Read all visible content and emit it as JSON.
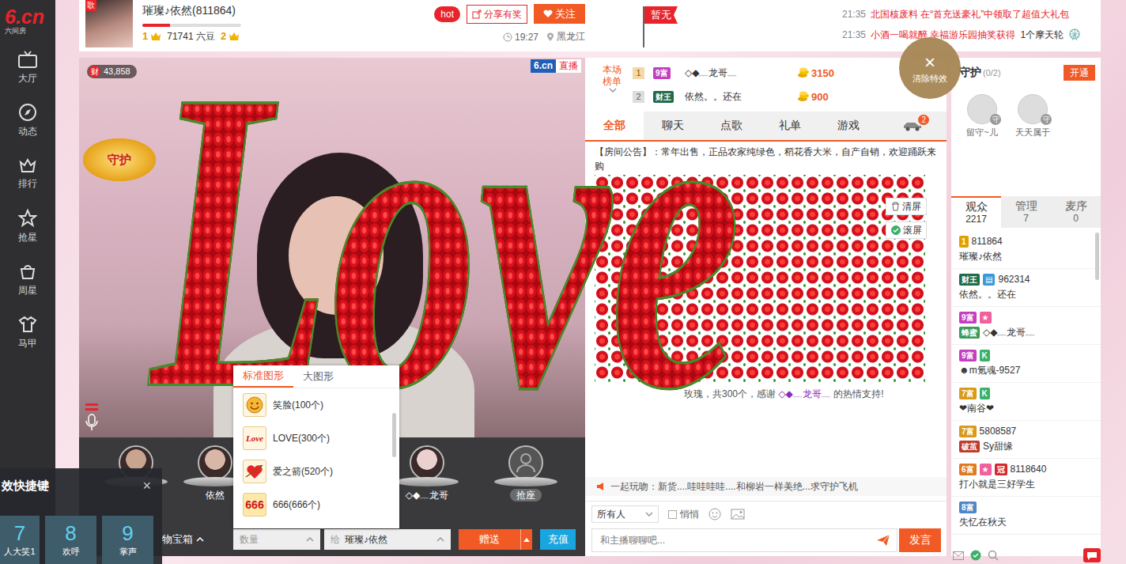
{
  "sidebar": {
    "logo": {
      "mark": "6.cn",
      "subtitle": "六间房"
    },
    "items": [
      {
        "label": "大厅",
        "kind": "tv"
      },
      {
        "label": "动态",
        "kind": "compass"
      },
      {
        "label": "排行",
        "kind": "crown"
      },
      {
        "label": "抢星",
        "kind": "star"
      },
      {
        "label": "周星",
        "kind": "basket"
      },
      {
        "label": "马甲",
        "kind": "shirt"
      }
    ]
  },
  "header": {
    "anchor_tag": "歌",
    "anchor_name": "璀璨♪依然(811864)",
    "progress": 0.28,
    "level_from": "1",
    "beans": "71741 六豆",
    "level_to": "2",
    "hot": "hot",
    "share": "分享有奖",
    "follow": "关注",
    "time": "19:27",
    "location": "黑龙江",
    "flag": "暂无"
  },
  "news": [
    {
      "time": "21:35",
      "text": "北国核废料 在“首充送豪礼”中领取了超值大礼包",
      "extra": ""
    },
    {
      "time": "21:35",
      "text": "小酒一喝就醉 幸福游乐园抽奖获得",
      "extra": "1个摩天轮"
    }
  ],
  "video": {
    "wealth_tag": "财",
    "wealth": "43,858",
    "brand": "6.cn",
    "live": "直播",
    "guard_badge": "守护"
  },
  "effect_overlay": {
    "text": "Love"
  },
  "clear_effects": {
    "icon": "×",
    "label": "清除特效"
  },
  "seats": [
    {
      "occupied": true,
      "label": ""
    },
    {
      "occupied": true,
      "label": "依然"
    },
    {
      "occupied": true,
      "label": "◇◆﹏龙哥"
    },
    {
      "occupied": false,
      "label": "抢座"
    }
  ],
  "shortcuts": {
    "title": "效快捷键",
    "close": "×",
    "keys": [
      {
        "num": "7",
        "label": "人大笑1"
      },
      {
        "num": "8",
        "label": "欢呼"
      },
      {
        "num": "9",
        "label": "掌声"
      }
    ]
  },
  "gift_bar": {
    "box": "物宝箱",
    "quantity": "数量",
    "to_prefix": "给",
    "recipient": "璀璨♪依然",
    "send": "赠送",
    "recharge": "充值"
  },
  "gift_menu": {
    "tabs": [
      {
        "label": "标准图形",
        "selected": true
      },
      {
        "label": "大图形",
        "selected": false
      }
    ],
    "items": [
      {
        "label": "笑脸(100个)",
        "kind": "smile",
        "icon_text": ""
      },
      {
        "label": "LOVE(300个)",
        "kind": "script",
        "icon_text": "Love"
      },
      {
        "label": "爱之箭(520个)",
        "kind": "arrow",
        "icon_text": ""
      },
      {
        "label": "666(666个)",
        "kind": "number",
        "icon_text": "666"
      }
    ]
  },
  "chat": {
    "rank_label": "本场榜单",
    "rank": [
      {
        "pos": "1",
        "badge": {
          "text": "9富",
          "color": "#c43fbf"
        },
        "name": "◇◆﹏龙哥﹏",
        "amount": "3150"
      },
      {
        "pos": "2",
        "badge": {
          "text": "财王",
          "color": "#1f6a4a"
        },
        "name": "依然。。还在",
        "amount": "900"
      }
    ],
    "tabs": [
      {
        "label": "全部",
        "selected": true
      },
      {
        "label": "聊天",
        "selected": false
      },
      {
        "label": "点歌",
        "selected": false
      },
      {
        "label": "礼单",
        "selected": false
      },
      {
        "label": "游戏",
        "selected": false
      }
    ],
    "car_badge": "2",
    "notice_label": "【房间公告】：",
    "notice": "常年出售，正品农家纯绿色，稻花香大米，自产自销，欢迎踊跃来购",
    "message": {
      "text": "玫瑰，共300个，感谢",
      "user": "◇◆﹏龙哥﹏",
      "suffix": "的热情支持!"
    },
    "clear": "清屏",
    "scroll": {
      "label": "滚屏",
      "checked": true
    },
    "promo": "一起玩吻：新货....哇哇哇哇....和柳岩一样美绝...求守护飞机",
    "target": "所有人",
    "whisper": {
      "label": "悄悄",
      "checked": false
    },
    "placeholder": "和主播聊聊吧...",
    "send": "发言"
  },
  "guard": {
    "title": "守护",
    "count": "(0/2)",
    "open": "开通",
    "members": [
      {
        "name": "留守~儿",
        "badge": "守"
      },
      {
        "name": "天天属于",
        "badge": "守"
      }
    ]
  },
  "audience": {
    "tabs": [
      {
        "label": "观众",
        "count": "2217",
        "selected": true
      },
      {
        "label": "管理",
        "count": "7",
        "selected": false
      },
      {
        "label": "麦序",
        "count": "0",
        "selected": false
      }
    ],
    "viewers": [
      {
        "badges": [
          {
            "text": "1",
            "color": "#e0a000"
          }
        ],
        "id": "811864",
        "sub_badge": null,
        "name": "璀璨♪依然"
      },
      {
        "badges": [
          {
            "text": "财王",
            "color": "#1f6a4a"
          },
          {
            "text": "▤",
            "color": "#3b9ad9"
          }
        ],
        "id": "962314",
        "sub_badge": null,
        "name": "依然。。还在"
      },
      {
        "badges": [
          {
            "text": "9富",
            "color": "#c43fbf"
          },
          {
            "text": "★",
            "color": "#f0609a"
          }
        ],
        "id": "",
        "sub_badge": {
          "text": "蜂蜜",
          "color": "#3a9a5a"
        },
        "name": "◇◆﹏龙哥﹏"
      },
      {
        "badges": [
          {
            "text": "9富",
            "color": "#c43fbf"
          },
          {
            "text": "K",
            "color": "#3bb06a"
          }
        ],
        "id": "",
        "sub_badge": null,
        "name": "☻m氪魂-9527"
      },
      {
        "badges": [
          {
            "text": "7富",
            "color": "#d99a1a"
          },
          {
            "text": "K",
            "color": "#3bb06a"
          }
        ],
        "id": "",
        "sub_badge": null,
        "name": "❤南谷❤"
      },
      {
        "badges": [
          {
            "text": "7富",
            "color": "#d99a1a"
          }
        ],
        "id": "5808587",
        "sub_badge": {
          "text": "破茧",
          "color": "#c0392b"
        },
        "name": "Sy甜缘"
      },
      {
        "badges": [
          {
            "text": "6富",
            "color": "#e07a20"
          },
          {
            "text": "★",
            "color": "#f0609a"
          },
          {
            "text": "冠",
            "color": "#d8262c"
          }
        ],
        "id": "8118640",
        "sub_badge": null,
        "name": "打小就是三好学生"
      },
      {
        "badges": [
          {
            "text": "8富",
            "color": "#4f86c6"
          }
        ],
        "id": "",
        "sub_badge": null,
        "name": "失忆在秋天"
      }
    ]
  }
}
